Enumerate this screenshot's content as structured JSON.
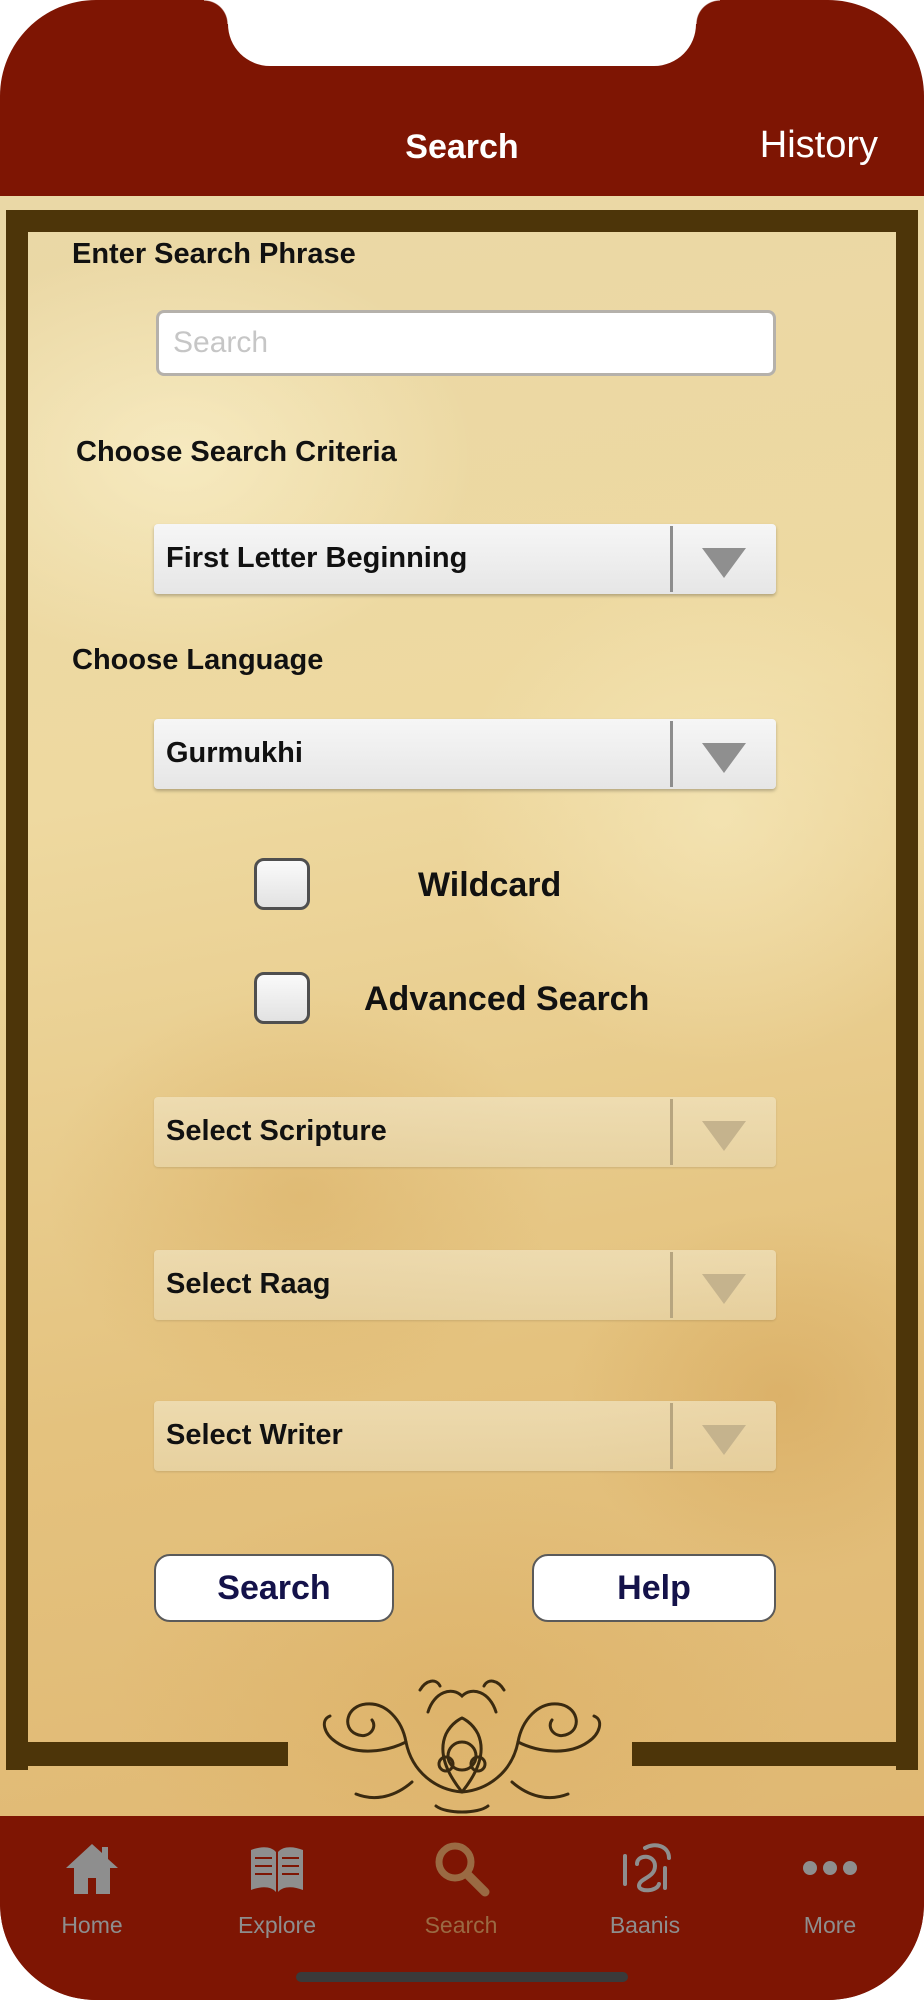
{
  "nav": {
    "title": "Search",
    "history_label": "History"
  },
  "form": {
    "phrase_label": "Enter Search Phrase",
    "search_placeholder": "Search",
    "search_value": "",
    "criteria_label": "Choose Search Criteria",
    "criteria_selected": "First Letter Beginning",
    "language_label": "Choose Language",
    "language_selected": "Gurmukhi",
    "wildcard_label": "Wildcard",
    "wildcard_checked": false,
    "advanced_label": "Advanced Search",
    "advanced_checked": false,
    "scripture_placeholder": "Select Scripture",
    "raag_placeholder": "Select Raag",
    "writer_placeholder": "Select Writer",
    "search_button": "Search",
    "help_button": "Help"
  },
  "tabbar": {
    "active": "Search",
    "items": [
      {
        "label": "Home",
        "icon": "home-icon"
      },
      {
        "label": "Explore",
        "icon": "book-icon"
      },
      {
        "label": "Search",
        "icon": "search-icon"
      },
      {
        "label": "Baanis",
        "icon": "ik-onkar-icon"
      },
      {
        "label": "More",
        "icon": "more-icon"
      }
    ]
  },
  "colors": {
    "brand_maroon": "#7e1503",
    "frame_brown": "#4d3509",
    "parchment": "#eed9a0",
    "tab_inactive": "#8e8e8e",
    "tab_active": "#9a6a43",
    "button_text": "#14124a"
  }
}
